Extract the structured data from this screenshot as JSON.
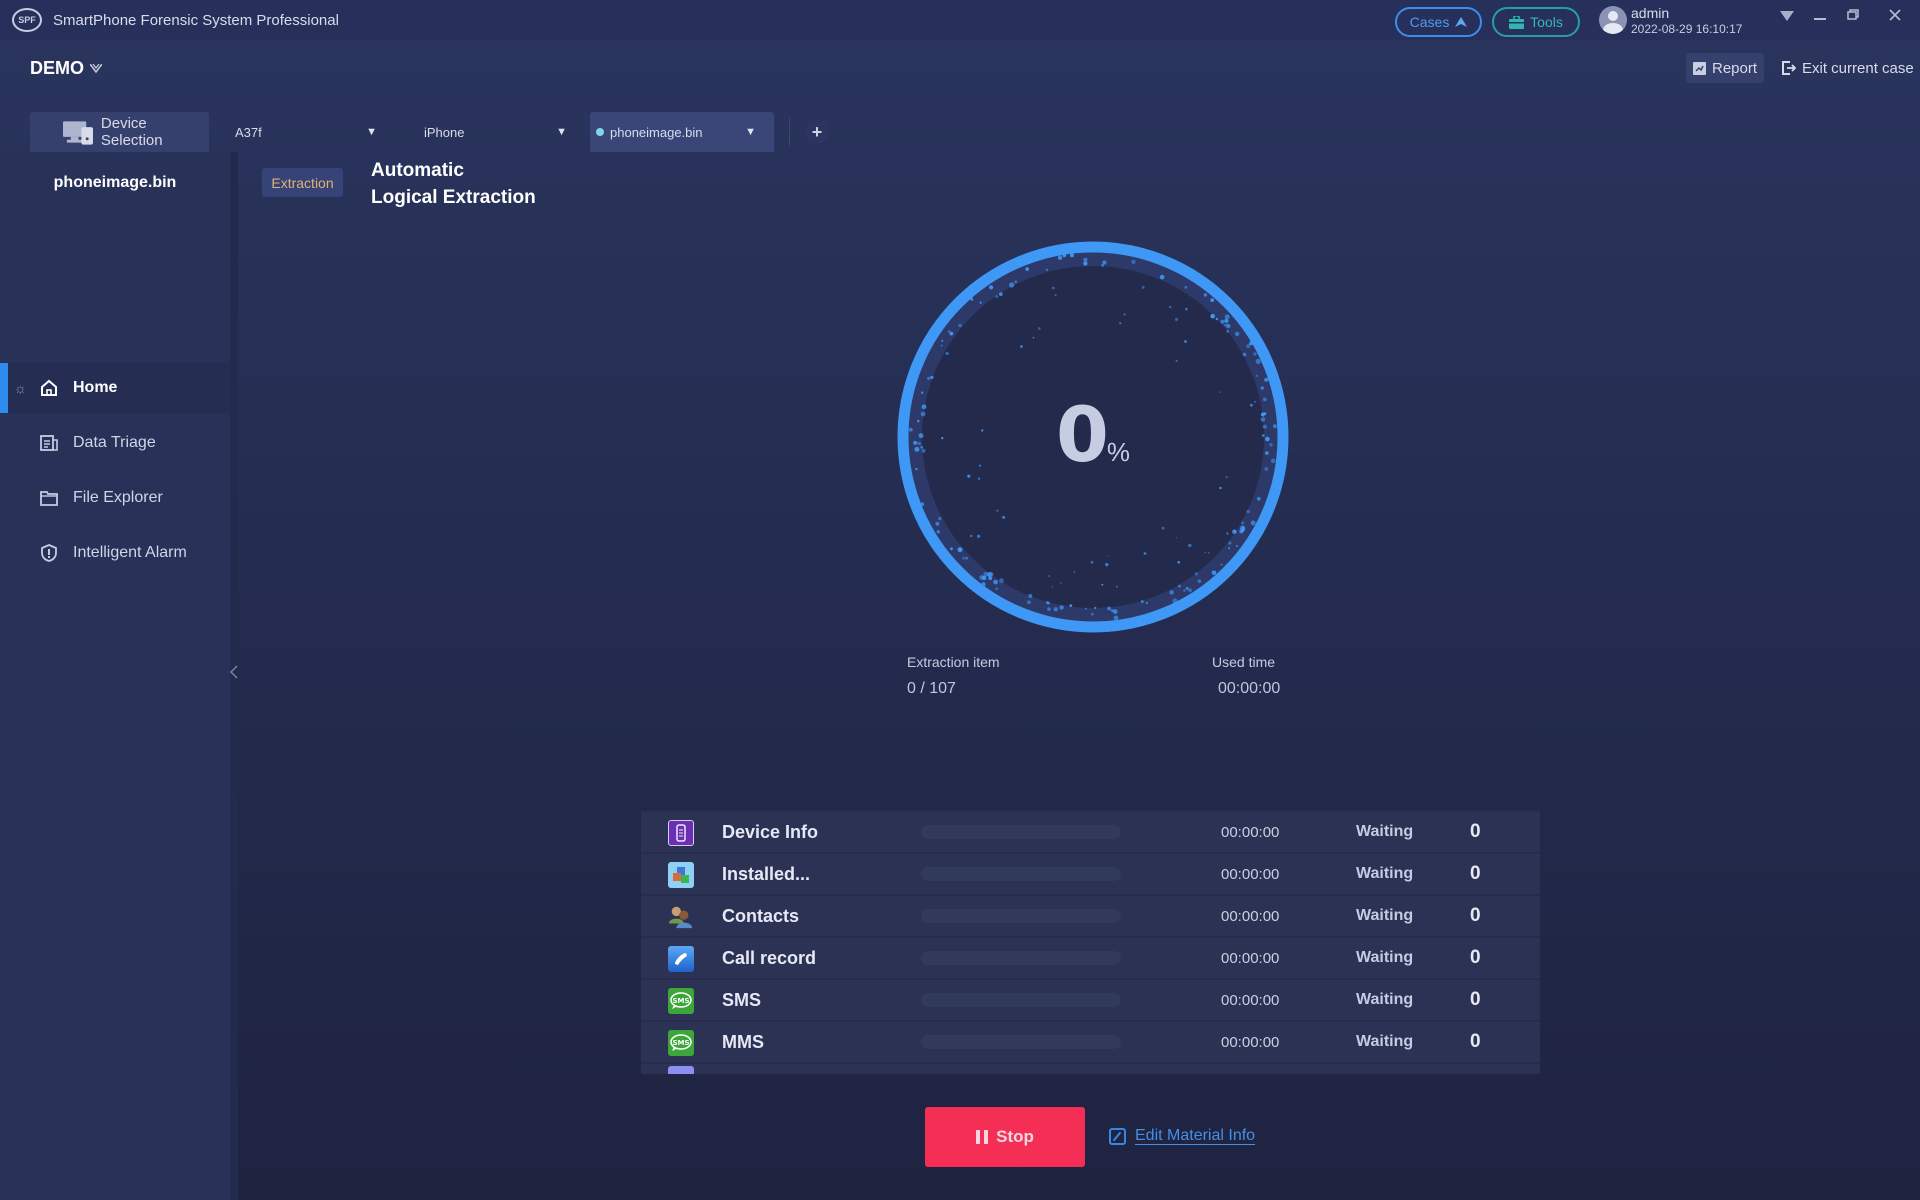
{
  "titlebar": {
    "app_title": "SmartPhone Forensic System Professional",
    "logo_text": "SPF",
    "cases_label": "Cases",
    "tools_label": "Tools",
    "user_name": "admin",
    "datetime": "2022-08-29 16:10:17",
    "icons": {
      "cases": "chevron-up-icon",
      "tools": "toolbox-icon",
      "menu": "triangle-down-icon",
      "minimize": "minimize-icon",
      "restore": "restore-icon",
      "close": "close-icon"
    }
  },
  "case": {
    "name": "DEMO",
    "report_label": "Report",
    "exit_label": "Exit current case"
  },
  "tabs": {
    "device_selection_label": "Device Selection",
    "model": "A37f",
    "device_type": "iPhone",
    "source": "phoneimage.bin",
    "source_status_color": "#7fd8e8",
    "add_label": "+"
  },
  "sidebar": {
    "device_name": "phoneimage.bin",
    "items": [
      {
        "label": "Home",
        "icon": "home-icon",
        "active": true
      },
      {
        "label": "Data Triage",
        "icon": "data-triage-icon",
        "active": false
      },
      {
        "label": "File Explorer",
        "icon": "folder-icon",
        "active": false
      },
      {
        "label": "Intelligent Alarm",
        "icon": "alarm-shield-icon",
        "active": false
      }
    ]
  },
  "main": {
    "badge": "Extraction",
    "title_line1": "Automatic",
    "title_line2": "Logical Extraction",
    "progress": {
      "value": "0",
      "unit": "%",
      "fraction": 0
    },
    "extraction_item_label": "Extraction item",
    "extraction_item_value": "0 / 107",
    "used_time_label": "Used time",
    "used_time_value": "00:00:00",
    "accent_color": "#3f98f5"
  },
  "items": [
    {
      "name": "Device Info",
      "icon": "device-info-icon",
      "time": "00:00:00",
      "status": "Waiting",
      "count": "0",
      "progress": 0
    },
    {
      "name": "Installed...",
      "icon": "installed-apps-icon",
      "time": "00:00:00",
      "status": "Waiting",
      "count": "0",
      "progress": 0
    },
    {
      "name": "Contacts",
      "icon": "contacts-icon",
      "time": "00:00:00",
      "status": "Waiting",
      "count": "0",
      "progress": 0
    },
    {
      "name": "Call record",
      "icon": "call-record-icon",
      "time": "00:00:00",
      "status": "Waiting",
      "count": "0",
      "progress": 0
    },
    {
      "name": "SMS",
      "icon": "sms-icon",
      "time": "00:00:00",
      "status": "Waiting",
      "count": "0",
      "progress": 0
    },
    {
      "name": "MMS",
      "icon": "mms-icon",
      "time": "00:00:00",
      "status": "Waiting",
      "count": "0",
      "progress": 0
    }
  ],
  "actions": {
    "stop_label": "Stop",
    "stop_color": "#f52e56",
    "edit_label": "Edit Material Info"
  }
}
